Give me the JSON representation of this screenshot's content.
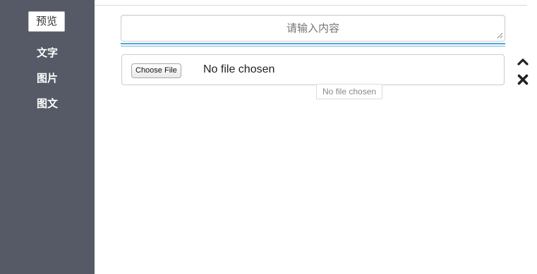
{
  "sidebar": {
    "preview_label": "预览",
    "items": [
      {
        "label": "文字"
      },
      {
        "label": "图片"
      },
      {
        "label": "图文"
      }
    ]
  },
  "editor": {
    "text_input": {
      "placeholder": "请输入内容",
      "value": ""
    },
    "file_input": {
      "button_label": "Choose File",
      "status": "No file chosen",
      "tooltip": "No file chosen"
    },
    "controls": {
      "move_up_icon": "chevron-up-icon",
      "remove_icon": "close-icon"
    }
  },
  "colors": {
    "sidebar_bg": "#555a66",
    "accent_line": "#4ba7d8"
  }
}
